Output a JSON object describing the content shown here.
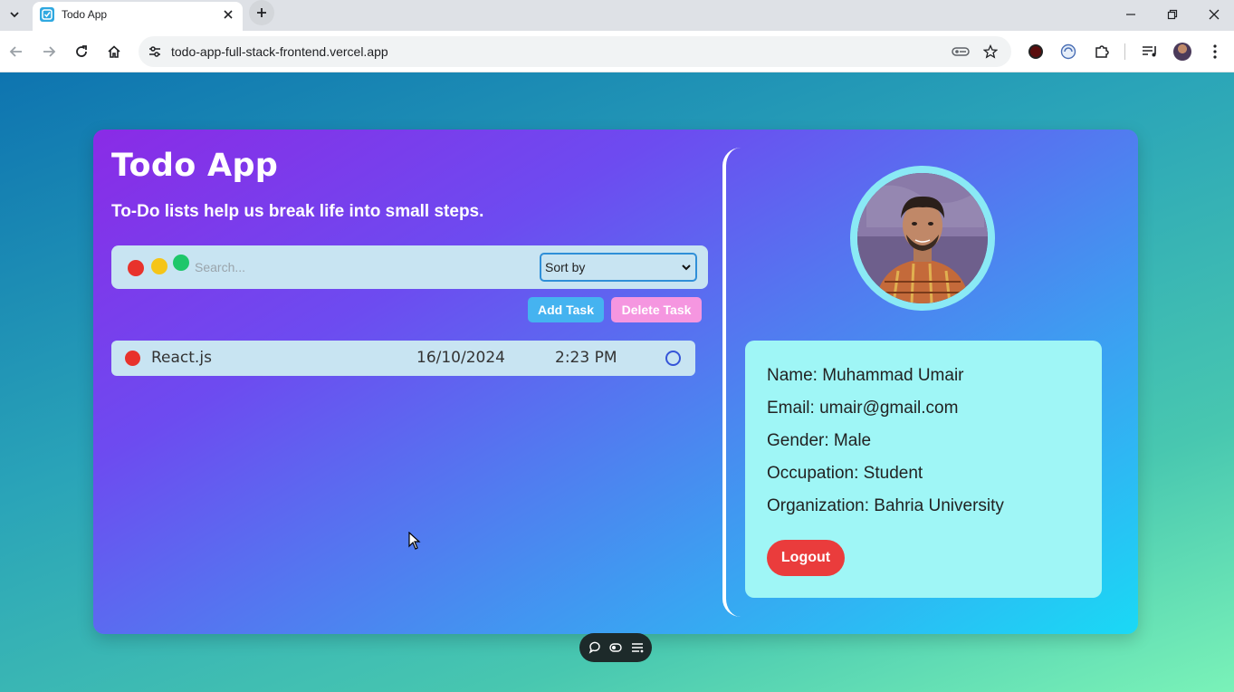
{
  "browser": {
    "tab_title": "Todo App",
    "url": "todo-app-full-stack-frontend.vercel.app"
  },
  "app": {
    "title": "Todo App",
    "subtitle": "To-Do lists help us break life into small steps."
  },
  "search": {
    "placeholder": "Search...",
    "sort_label": "Sort by"
  },
  "actions": {
    "add_label": "Add Task",
    "delete_label": "Delete Task"
  },
  "tasks": [
    {
      "name": "React.js",
      "date": "16/10/2024",
      "time": "2:23 PM",
      "priority_color": "#e8322c",
      "completed": false
    }
  ],
  "profile": {
    "name": "Name: Muhammad Umair",
    "email": "Email: umair@gmail.com",
    "gender": "Gender: Male",
    "occupation": "Occupation: Student",
    "organization": "Organization: Bahria University",
    "logout_label": "Logout"
  },
  "colors": {
    "dot_red": "#e8322c",
    "dot_yellow": "#f5c518",
    "dot_green": "#1ec76a",
    "accent_blue": "#45b3f0",
    "accent_pink": "#f596e0",
    "logout_red": "#ea3c3c"
  },
  "icons": {
    "tab_dropdown": "chevron-down-icon",
    "tab_favicon": "todo-check-icon",
    "tab_close": "close-icon",
    "new_tab": "plus-icon",
    "back": "back-arrow-icon",
    "forward": "forward-arrow-icon",
    "reload": "reload-icon",
    "home": "home-icon",
    "site_info": "tune-icon",
    "password": "key-icon",
    "bookmark": "star-icon",
    "extensions": "puzzle-icon",
    "menu": "kebab-icon"
  }
}
